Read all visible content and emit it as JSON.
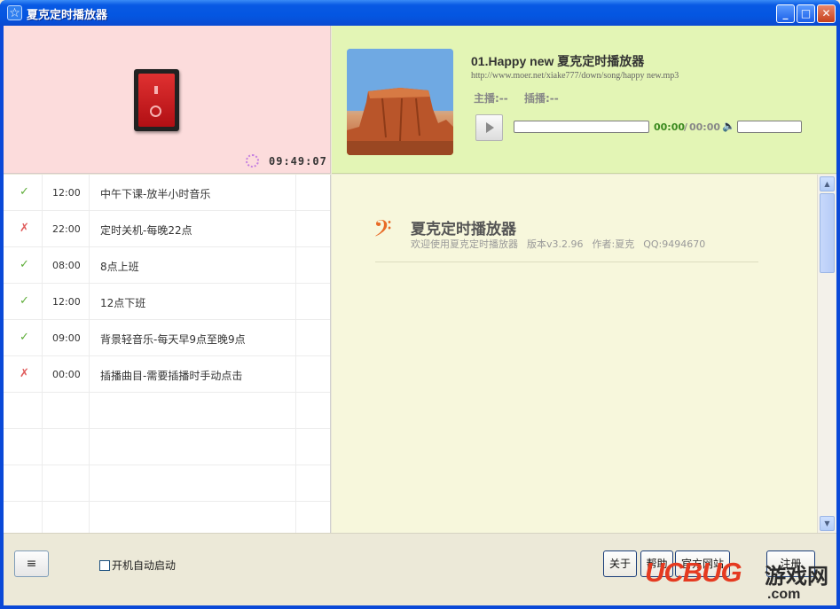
{
  "window": {
    "title": "夏克定时播放器",
    "minimize_label": "_",
    "maximize_label": "□",
    "close_label": "✕"
  },
  "clock": {
    "time": "09:49:07"
  },
  "player": {
    "song_title": "01.Happy new 夏克定时播放器",
    "song_url": "http://www.moer.net/xiake777/down/song/happy new.mp3",
    "host_label": "主播:--",
    "insert_label": "插播:--",
    "time_current": "00:00",
    "time_separator": "/",
    "time_total": "00:00",
    "progress": 0,
    "volume_level": 0
  },
  "schedule": {
    "rows": [
      {
        "status": "✓",
        "enabled": true,
        "time": "12:00",
        "label": "中午下课-放半小时音乐"
      },
      {
        "status": "✗",
        "enabled": false,
        "time": "22:00",
        "label": "定时关机-每晚22点"
      },
      {
        "status": "✓",
        "enabled": true,
        "time": "08:00",
        "label": "8点上班"
      },
      {
        "status": "✓",
        "enabled": true,
        "time": "12:00",
        "label": "12点下班"
      },
      {
        "status": "✓",
        "enabled": true,
        "time": "09:00",
        "label": "背景轻音乐-每天早9点至晚9点"
      },
      {
        "status": "✗",
        "enabled": false,
        "time": "00:00",
        "label": "插播曲目-需要插播时手动点击"
      }
    ]
  },
  "info": {
    "title": "夏克定时播放器",
    "welcome": "欢迎使用夏克定时播放器",
    "version": "版本v3.2.96",
    "author": "作者:夏克",
    "qq": "QQ:9494670"
  },
  "bottom": {
    "menu_label": "≡",
    "autostart_label": "开机自动启动",
    "about_label": "关于",
    "help_label": "帮助",
    "site_label": "官方网站",
    "register_label": "注册"
  },
  "watermark": {
    "brand": "UCBUG",
    "cn": "游戏网",
    "domain": ".com"
  },
  "colors": {
    "titlebar": "#0456e1",
    "clock_panel": "#fcdcdc",
    "player_panel": "#e3f5b5",
    "info_panel": "#f7f7dc",
    "ok_status": "#5fae3a",
    "no_status": "#e05c5c",
    "accent_orange": "#e86a26"
  }
}
